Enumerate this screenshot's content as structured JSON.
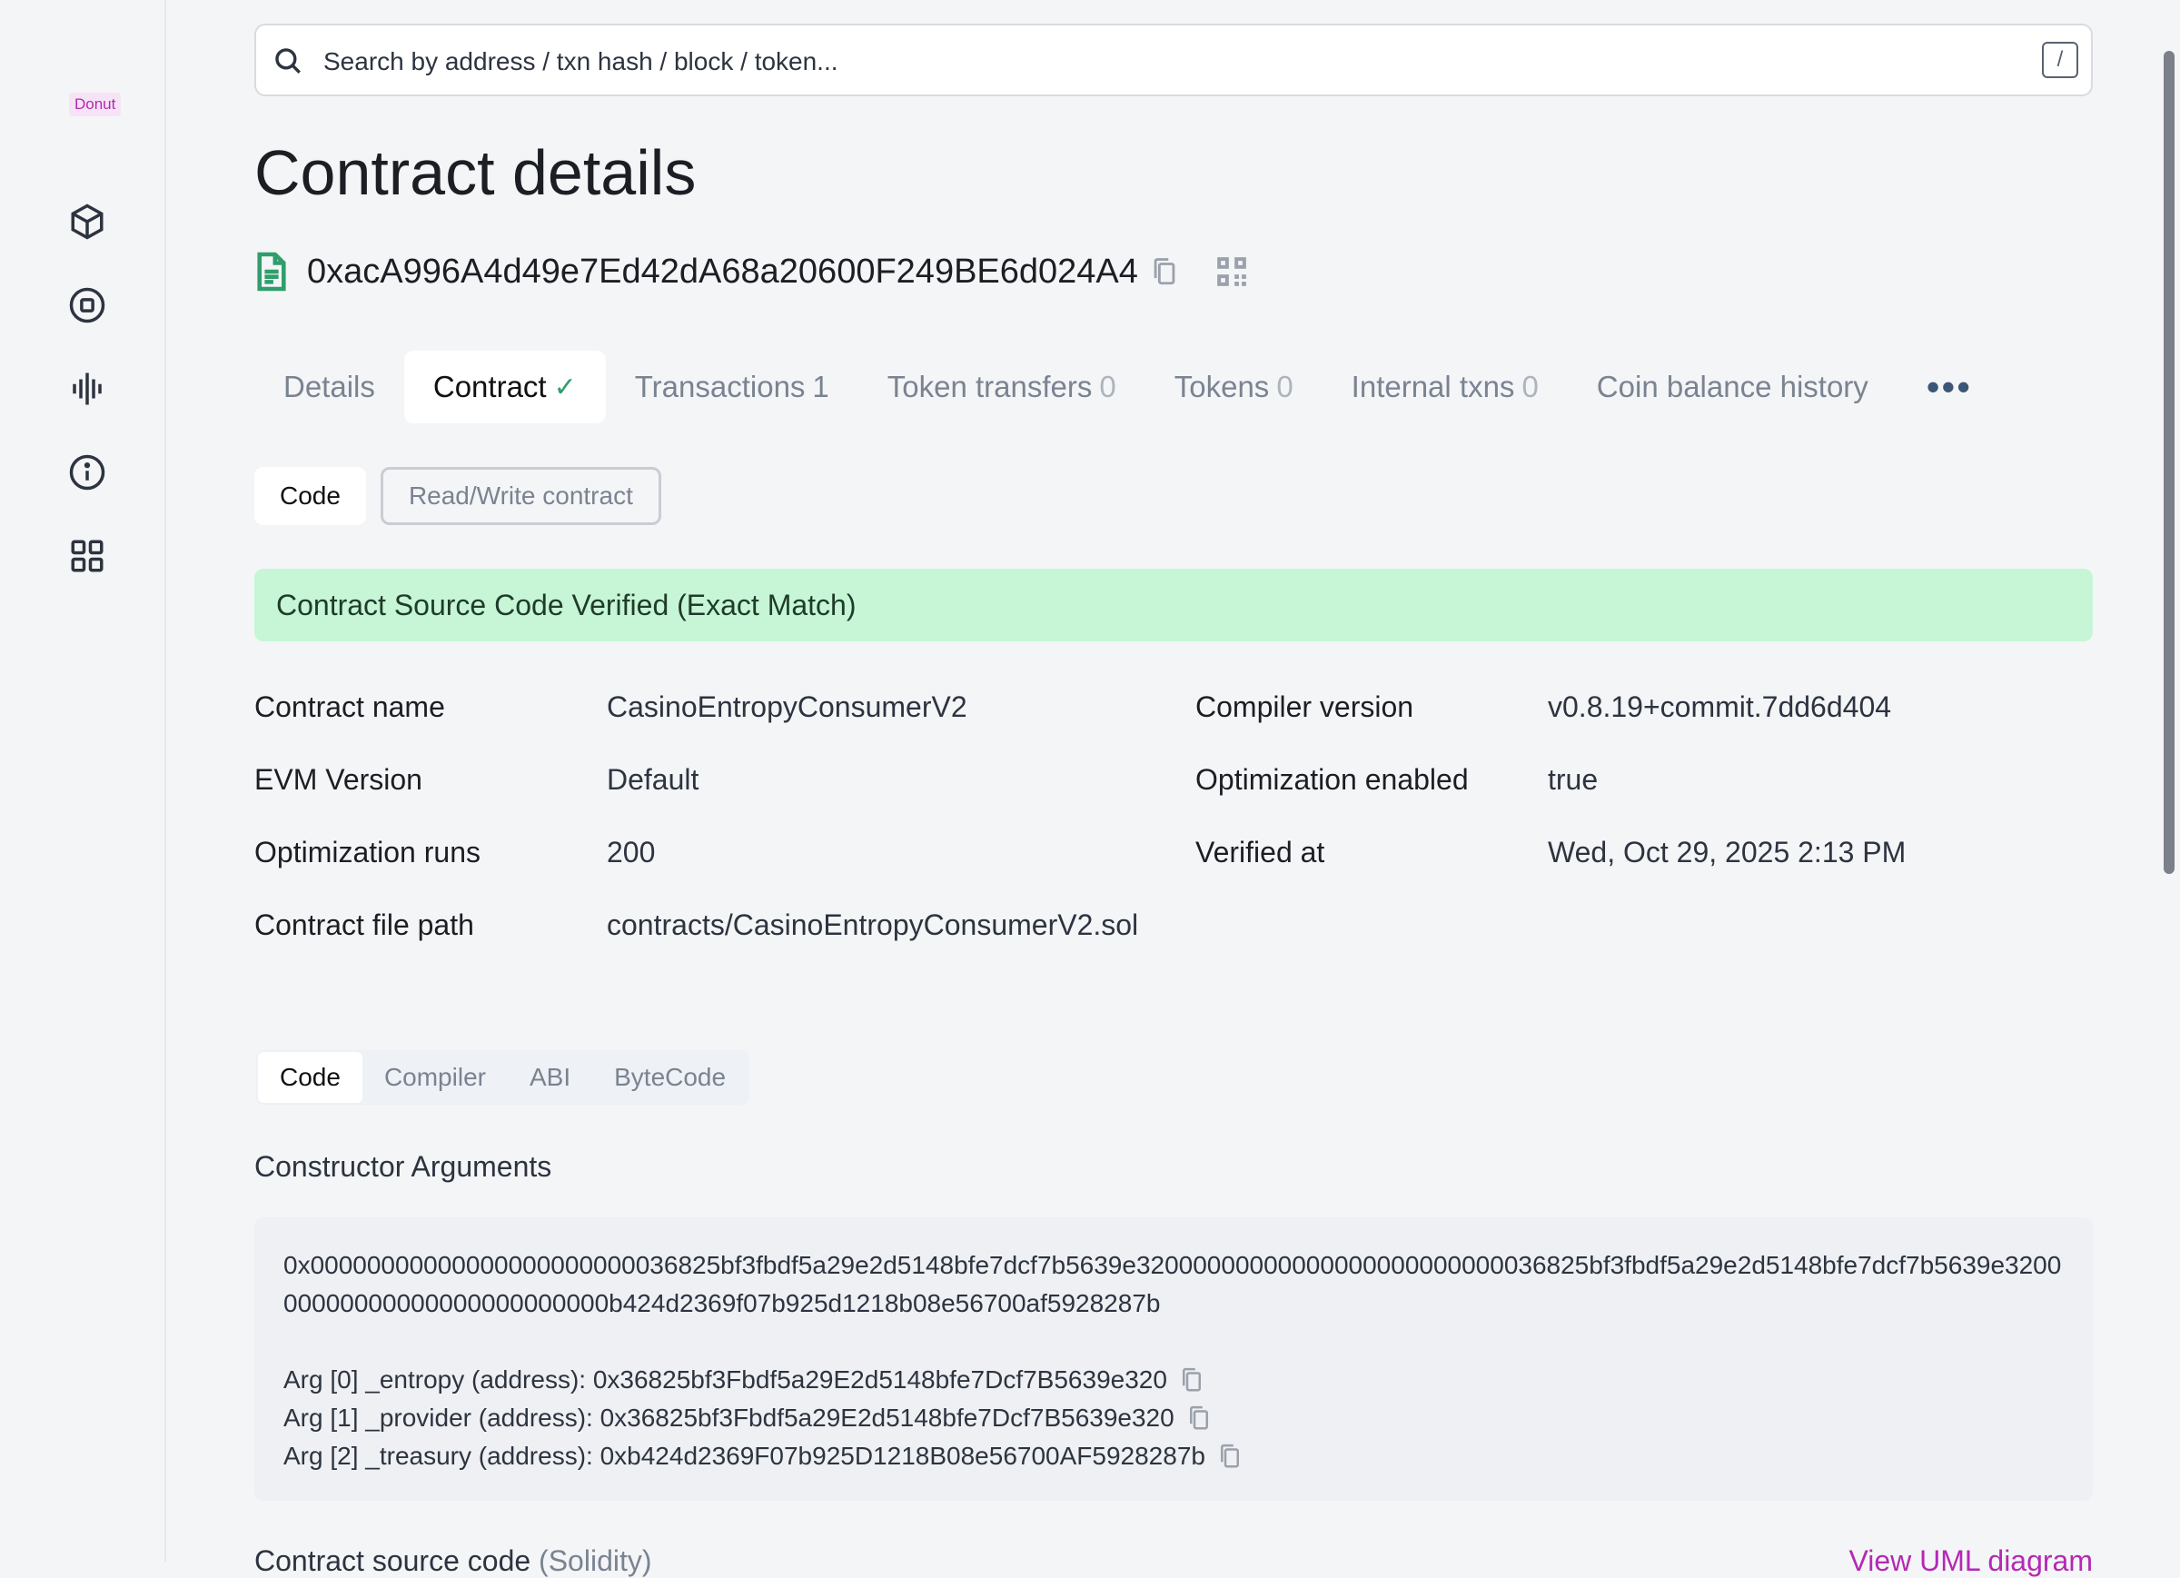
{
  "sidebar": {
    "logo": "Donut",
    "icons": [
      "cube-icon",
      "stop-circle-icon",
      "waveform-icon",
      "info-icon",
      "grid-icon"
    ]
  },
  "search": {
    "placeholder": "Search by address / txn hash / block / token...",
    "shortcut": "/"
  },
  "page": {
    "title": "Contract details",
    "address": "0xacA996A4d49e7Ed42dA68a20600F249BE6d024A4"
  },
  "tabs": [
    {
      "label": "Details",
      "count": ""
    },
    {
      "label": "Contract",
      "count": ""
    },
    {
      "label": "Transactions",
      "count": "1"
    },
    {
      "label": "Token transfers",
      "count": "0"
    },
    {
      "label": "Tokens",
      "count": "0"
    },
    {
      "label": "Internal txns",
      "count": "0"
    },
    {
      "label": "Coin balance history",
      "count": ""
    }
  ],
  "more_label": "•••",
  "subtabs": {
    "code": "Code",
    "read_write": "Read/Write contract"
  },
  "verified_banner": "Contract Source Code Verified (Exact Match)",
  "details": {
    "contract_name": {
      "label": "Contract name",
      "value": "CasinoEntropyConsumerV2"
    },
    "compiler_version": {
      "label": "Compiler version",
      "value": "v0.8.19+commit.7dd6d404"
    },
    "evm_version": {
      "label": "EVM Version",
      "value": "Default"
    },
    "optimization_enabled": {
      "label": "Optimization enabled",
      "value": "true"
    },
    "optimization_runs": {
      "label": "Optimization runs",
      "value": "200"
    },
    "verified_at": {
      "label": "Verified at",
      "value": "Wed, Oct 29, 2025 2:13 PM"
    },
    "file_path": {
      "label": "Contract file path",
      "value": "contracts/CasinoEntropyConsumerV2.sol"
    }
  },
  "code_tabs": [
    "Code",
    "Compiler",
    "ABI",
    "ByteCode"
  ],
  "constructor": {
    "title": "Constructor Arguments",
    "hex": "0x00000000000000000000000036825bf3fbdf5a29e2d5148bfe7dcf7b5639e32000000000000000000000000036825bf3fbdf5a29e2d5148bfe7dcf7b5639e320000000000000000000000000b424d2369f07b925d1218b08e56700af5928287b",
    "args": [
      "Arg [0] _entropy (address): 0x36825bf3Fbdf5a29E2d5148bfe7Dcf7B5639e320",
      "Arg [1] _provider (address): 0x36825bf3Fbdf5a29E2d5148bfe7Dcf7B5639e320",
      "Arg [2] _treasury (address): 0xb424d2369F07b925D1218B08e56700AF5928287b"
    ]
  },
  "source": {
    "title": "Contract source code",
    "lang": "(Solidity)",
    "uml_link": "View UML diagram"
  },
  "colors": {
    "accent_pink": "#b429b4",
    "verified_bg": "#c6f6d5",
    "check_green": "#2f9e6a"
  }
}
